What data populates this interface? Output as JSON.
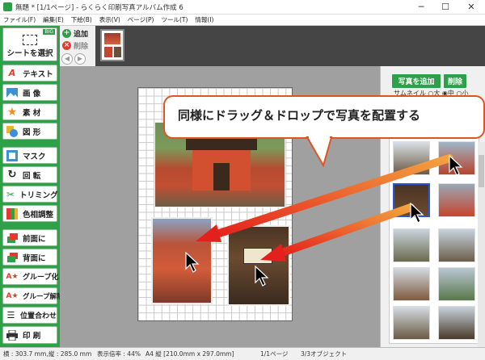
{
  "window": {
    "title": "無題 * [1/1ページ] - らくらく印刷写真アルバム作成 6",
    "minimize": "─",
    "maximize": "☐",
    "close": "✕"
  },
  "menu": [
    "ファイル(F)",
    "編集(E)",
    "下絵(B)",
    "表示(V)",
    "ページ(P)",
    "ツール(T)",
    "情報(I)"
  ],
  "left_panel": {
    "select_sheet": "シートを選択",
    "version_badge": "BIG",
    "tools": [
      "テキスト",
      "画 像",
      "素 材",
      "図 形",
      "マスク",
      "回 転",
      "トリミング",
      "色相調整",
      "前面に",
      "背面に",
      "グループ化",
      "グループ解除",
      "位置合わせ",
      "印 刷"
    ]
  },
  "page_controls": {
    "add": "追加",
    "delete": "削除"
  },
  "right_panel": {
    "add_photo": "写真を追加",
    "delete": "削除",
    "thumb_size_label": "サムネイル",
    "size_options": [
      "大",
      "中",
      "小"
    ],
    "selected_size": "中"
  },
  "callout": {
    "text": "同様にドラッグ＆ドロップで写真を配置する"
  },
  "status": {
    "width": "横 : 303.7 mm,",
    "height": "縦 : 285.0 mm",
    "zoom": "表示倍率 : 44%",
    "paper": "A4 縦 [210.0mm x 297.0mm]",
    "page": "1/1ページ",
    "objects": "3/3オブジェクト"
  },
  "colors": {
    "accent": "#2da048",
    "callout_border": "#e0541f",
    "arrow_red": "#e4201c",
    "arrow_orange": "#f3a340"
  }
}
